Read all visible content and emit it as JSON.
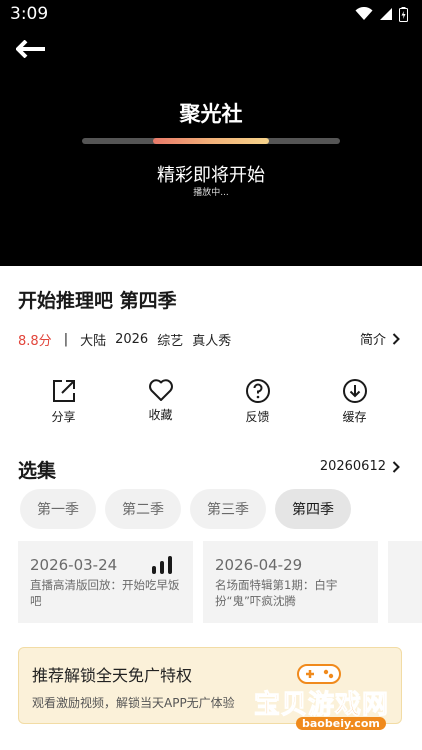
{
  "status_bar": {
    "time": "3:09"
  },
  "player": {
    "title": "聚光社",
    "status": "精彩即将开始",
    "substatus": "播放中...",
    "progress": 0.45
  },
  "show": {
    "title": "开始推理吧 第四季",
    "rating": "8.8分",
    "separator": "|",
    "tags": [
      "大陆",
      "2026",
      "综艺",
      "真人秀"
    ],
    "intro_label": "简介"
  },
  "actions": [
    {
      "label": "分享",
      "icon": "share-icon"
    },
    {
      "label": "收藏",
      "icon": "heart-icon"
    },
    {
      "label": "反馈",
      "icon": "help-icon"
    },
    {
      "label": "缓存",
      "icon": "download-icon"
    }
  ],
  "episodes": {
    "heading": "选集",
    "latest_date": "20260612",
    "seasons": [
      "第一季",
      "第二季",
      "第三季",
      "第四季"
    ],
    "active_season": 3,
    "cards": [
      {
        "date": "2026-03-24",
        "desc": "直播高清版回放：开始吃早饭吧",
        "playing": true
      },
      {
        "date": "2026-04-29",
        "desc": "名场面特辑第1期：白宇扮“鬼”吓疯沈腾",
        "playing": false
      }
    ]
  },
  "promo": {
    "title": "推荐解锁全天免广特权",
    "subtitle": "观看激励视频，解锁当天APP无广体验"
  },
  "watermark": {
    "text": "宝贝游戏网",
    "url": "baobeiy.com"
  },
  "colors": {
    "rating": "#e2463c",
    "promo_bg": "#fbf1d9",
    "watermark": "#f08a1c"
  }
}
